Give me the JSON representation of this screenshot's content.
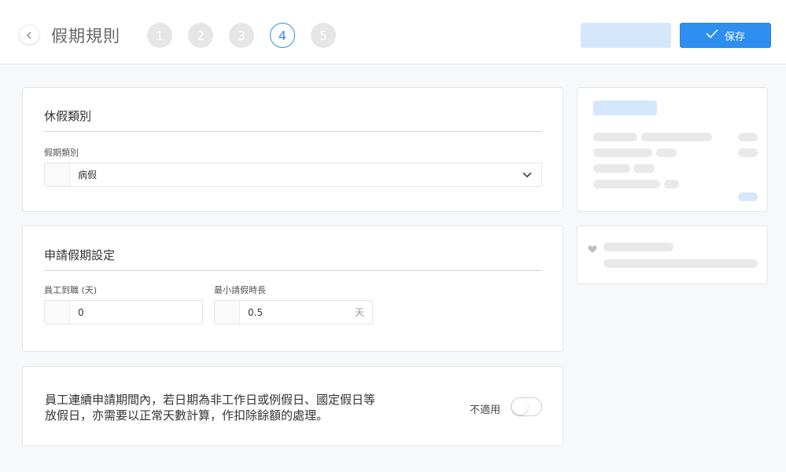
{
  "header": {
    "title": "假期規則",
    "steps": [
      "1",
      "2",
      "3",
      "4",
      "5"
    ],
    "active_step": "4",
    "save_label": "保存"
  },
  "leave_type_section": {
    "title": "休假類別",
    "field_label": "假期類別",
    "selected_value": "病假"
  },
  "apply_section": {
    "title": "申請假期設定",
    "tenure_label": "員工到職 (天)",
    "tenure_value": "0",
    "min_duration_label": "最小請假時長",
    "min_duration_value": "0.5",
    "min_duration_unit": "天"
  },
  "holiday_rule": {
    "text": "員工連續申請期間內，若日期為非工作日或例假日、國定假日等放假日，亦需要以正常天數計算，作扣除餘額的處理。",
    "toggle_label": "不適用",
    "toggle_on": false
  },
  "colors": {
    "primary": "#2e8ff0",
    "primary_light": "#d5e8fb",
    "step_inactive": "#e6e6e6"
  }
}
